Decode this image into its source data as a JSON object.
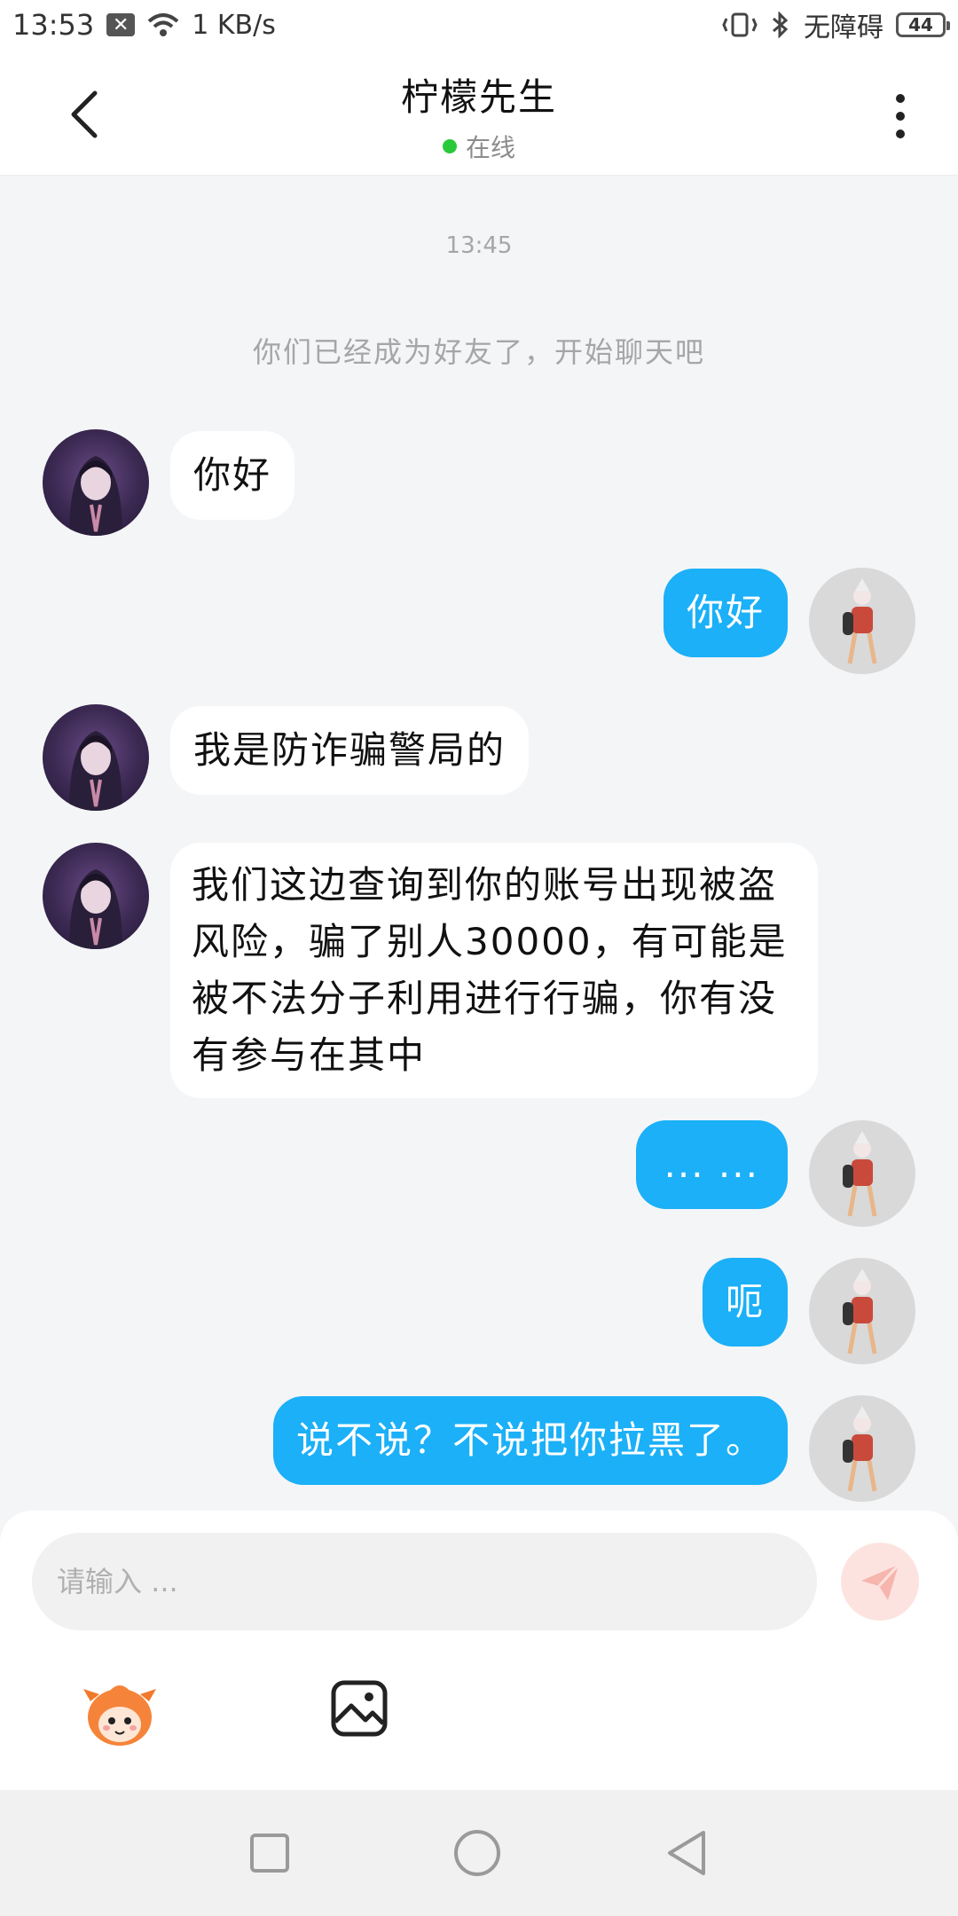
{
  "status_bar": {
    "time": "13:53",
    "speed": "1 KB/s",
    "accessibility": "无障碍",
    "battery": "44"
  },
  "header": {
    "title": "柠檬先生",
    "status": "在线"
  },
  "chat": {
    "time": "13:45",
    "system_message": "你们已经成为好友了，开始聊天吧",
    "messages": [
      {
        "from": "other",
        "text": "你好"
      },
      {
        "from": "me",
        "text": "你好"
      },
      {
        "from": "other",
        "text": "我是防诈骗警局的"
      },
      {
        "from": "other",
        "text": "我们这边查询到你的账号出现被盗风险，骗了别人30000，有可能是被不法分子利用进行行骗，你有没有参与在其中"
      },
      {
        "from": "me",
        "text": "... ..."
      },
      {
        "from": "me",
        "text": "呃"
      },
      {
        "from": "me",
        "text": "说不说？不说把你拉黑了。"
      }
    ]
  },
  "composer": {
    "placeholder": "请输入 ..."
  },
  "colors": {
    "accent": "#1bb0f7",
    "online": "#2ac93a"
  }
}
